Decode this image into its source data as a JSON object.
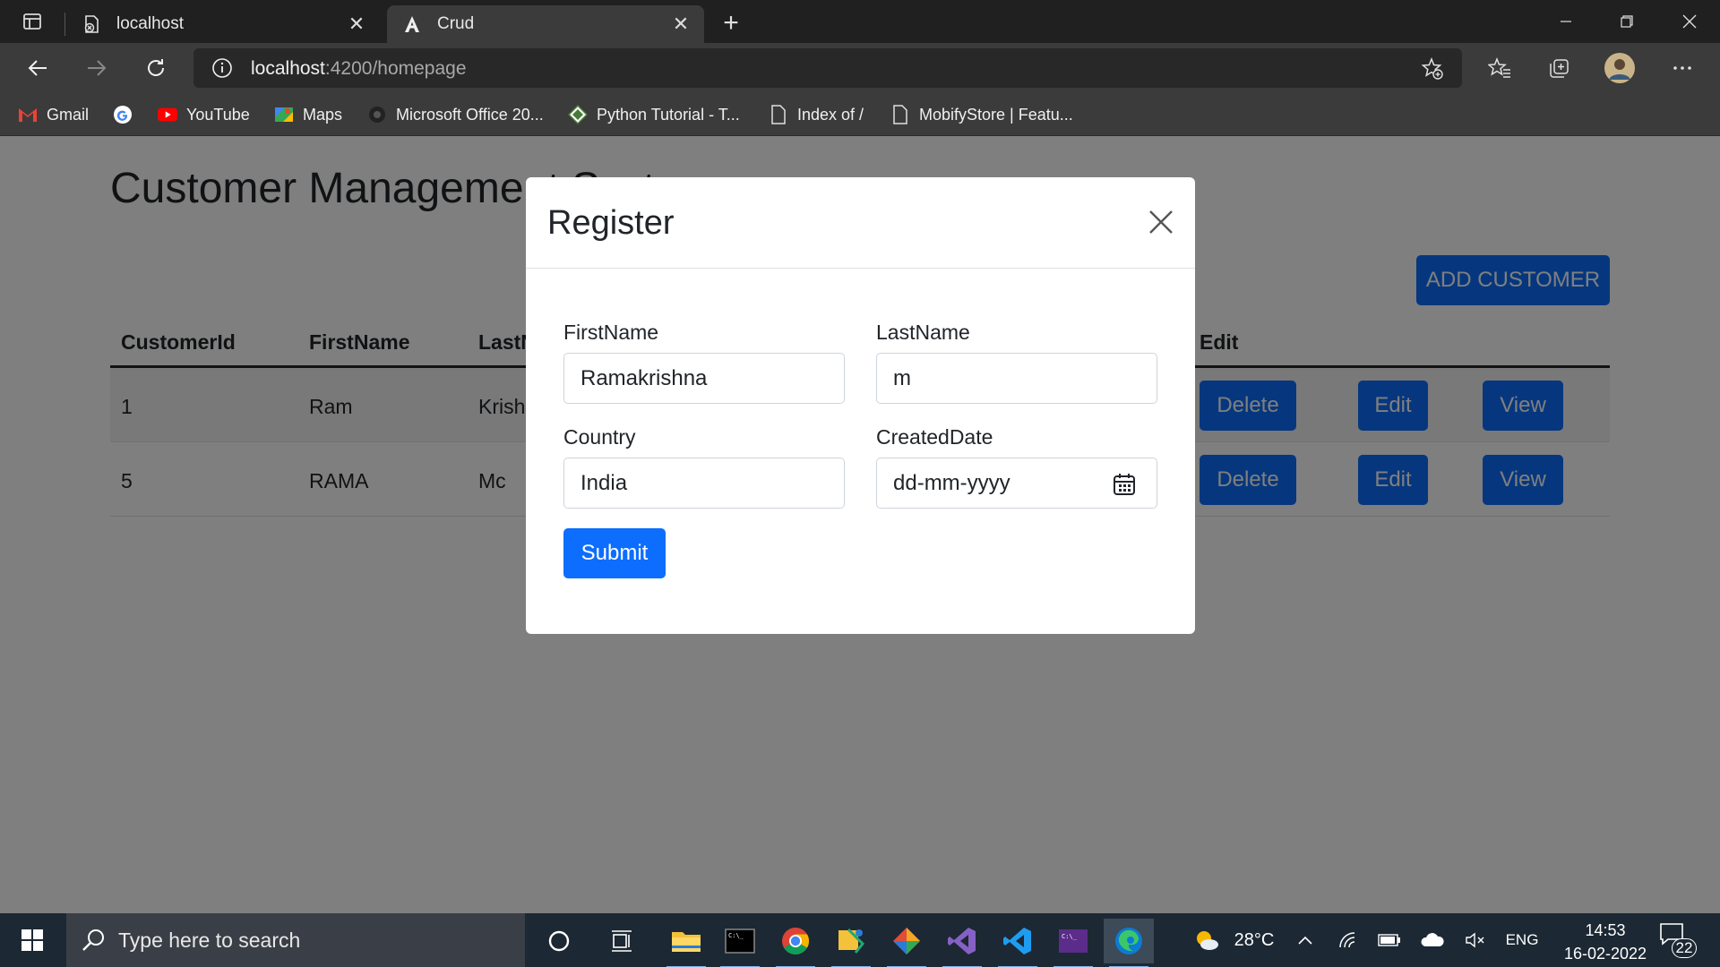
{
  "browser": {
    "tabs": [
      {
        "title": "localhost",
        "icon": "page-blocked-icon"
      },
      {
        "title": "Crud",
        "icon": "angular-icon"
      }
    ],
    "new_tab": "+",
    "url_host": "localhost",
    "url_path": ":4200/homepage",
    "bookmarks": [
      {
        "label": "Gmail",
        "icon": "gmail-icon",
        "color": "#ea4335"
      },
      {
        "label": "",
        "icon": "google-icon",
        "color": "#4285f4"
      },
      {
        "label": "YouTube",
        "icon": "youtube-icon",
        "color": "#ff0000"
      },
      {
        "label": "Maps",
        "icon": "maps-icon",
        "color": "#34a853"
      },
      {
        "label": "Microsoft Office 20...",
        "icon": "office-icon",
        "color": "#333333"
      },
      {
        "label": "Python Tutorial - T...",
        "icon": "python-site-icon",
        "color": "#4a7a3a"
      },
      {
        "label": "Index of /",
        "icon": "page-icon",
        "color": "#e0e0e0"
      },
      {
        "label": "MobifyStore | Featu...",
        "icon": "page-icon",
        "color": "#e0e0e0"
      }
    ]
  },
  "page": {
    "title": "Customer Management System",
    "add_button": "ADD CUSTOMER",
    "table": {
      "headers": [
        "CustomerId",
        "FirstName",
        "LastName",
        "Edit"
      ],
      "rows": [
        {
          "id": "1",
          "first": "Ram",
          "last": "Krishna"
        },
        {
          "id": "5",
          "first": "RAMA",
          "last": "Mc"
        }
      ],
      "actions": [
        "Delete",
        "Edit",
        "View"
      ]
    }
  },
  "modal": {
    "title": "Register",
    "fields": {
      "firstname_label": "FirstName",
      "firstname_value": "Ramakrishna",
      "lastname_label": "LastName",
      "lastname_value": "m",
      "country_label": "Country",
      "country_value": "India",
      "created_label": "CreatedDate",
      "created_placeholder": "dd-mm-yyyy"
    },
    "submit": "Submit"
  },
  "taskbar": {
    "search_placeholder": "Type here to search",
    "temperature": "28°C",
    "language": "ENG",
    "time": "14:53",
    "date": "16-02-2022",
    "notifications": "22"
  },
  "colors": {
    "primary": "#0d6efd",
    "chrome_dark": "#202020",
    "chrome_mid": "#3b3b3b"
  }
}
